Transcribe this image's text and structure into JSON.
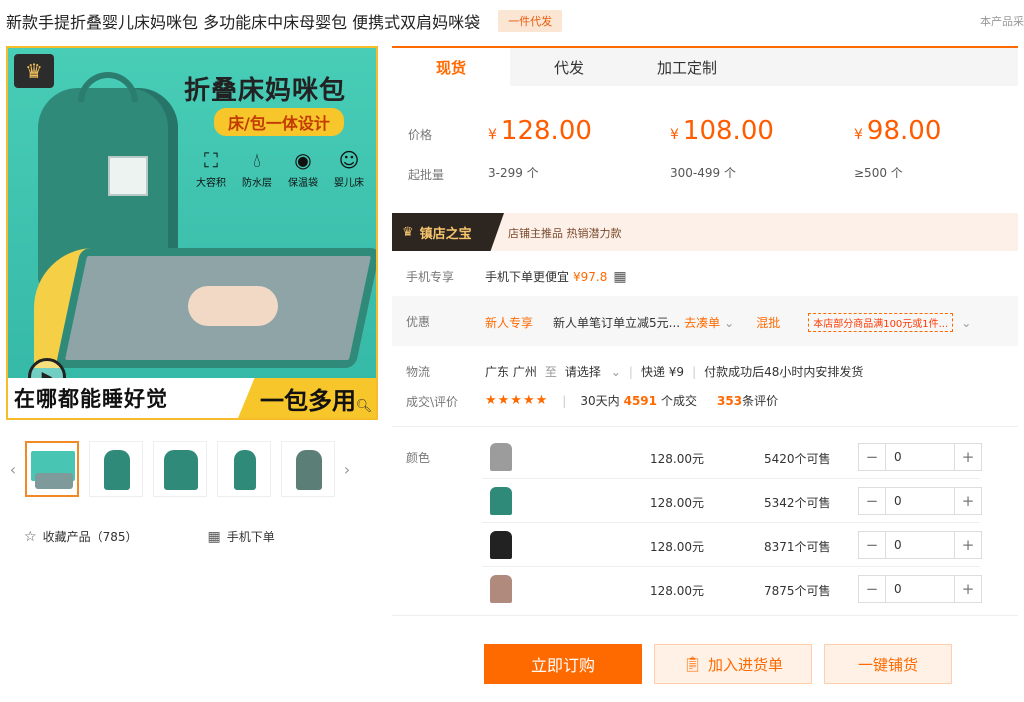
{
  "header": {
    "title": "新款手提折叠婴儿床妈咪包 多功能床中床母婴包 便携式双肩妈咪袋",
    "badge": "一件代发",
    "note": "本产品采"
  },
  "gallery": {
    "promo_title": "折叠床妈咪包",
    "promo_sub": "床/包一体设计",
    "features": [
      "大容积",
      "防水层",
      "保温袋",
      "婴儿床"
    ],
    "banner_left": "在哪都能睡好觉",
    "banner_right": "一包多用",
    "thumb_active_title": "折叠床妈咪包"
  },
  "actions": {
    "favorite_label": "收藏产品（785）",
    "mobile_label": "手机下单"
  },
  "tabs": [
    {
      "label": "现货"
    },
    {
      "label": "代发"
    },
    {
      "label": "加工定制"
    }
  ],
  "pricing": {
    "price_label": "价格",
    "qty_label": "起批量",
    "currency": "¥",
    "tiers": [
      {
        "price": "128.00",
        "qty": "3-299 个"
      },
      {
        "price": "108.00",
        "qty": "300-499 个"
      },
      {
        "price": "98.00",
        "qty": "≥500 个"
      }
    ]
  },
  "treasure": {
    "tag": "镇店之宝",
    "text": "店铺主推品  热销潜力款"
  },
  "mobile": {
    "label": "手机专享",
    "text": "手机下单更便宜",
    "price": "¥97.8"
  },
  "discount": {
    "label": "优惠",
    "new_user": "新人专享",
    "desc": "新人单笔订单立减5元...",
    "link": "去凑单",
    "mix": "混批",
    "promo": "本店部分商品满100元或1件..."
  },
  "logistics": {
    "label": "物流",
    "origin": "广东 广州",
    "to": "至",
    "select": "请选择",
    "express": "快递 ¥9",
    "ship": "付款成功后48小时内安排发货"
  },
  "reviews": {
    "label": "成交\\评价",
    "stars": "★★★★★",
    "days": "30天内",
    "count": "4591",
    "count_suffix": "个成交",
    "eval": "353",
    "eval_suffix": "条评价"
  },
  "variants": {
    "label": "颜色",
    "items": [
      {
        "color": "#9c9c9c",
        "price": "128.00元",
        "stock": "5420个可售",
        "qty": "0"
      },
      {
        "color": "#2f8a7a",
        "price": "128.00元",
        "stock": "5342个可售",
        "qty": "0"
      },
      {
        "color": "#222222",
        "price": "128.00元",
        "stock": "8371个可售",
        "qty": "0"
      },
      {
        "color": "#b08a7c",
        "price": "128.00元",
        "stock": "7875个可售",
        "qty": "0"
      }
    ]
  },
  "buttons": {
    "buy": "立即订购",
    "cart": "加入进货单",
    "onekey": "一键铺货"
  },
  "colors": {
    "accent": "#ff6a00",
    "teal": "#2f8a7a",
    "yellow": "#f7c62a"
  }
}
